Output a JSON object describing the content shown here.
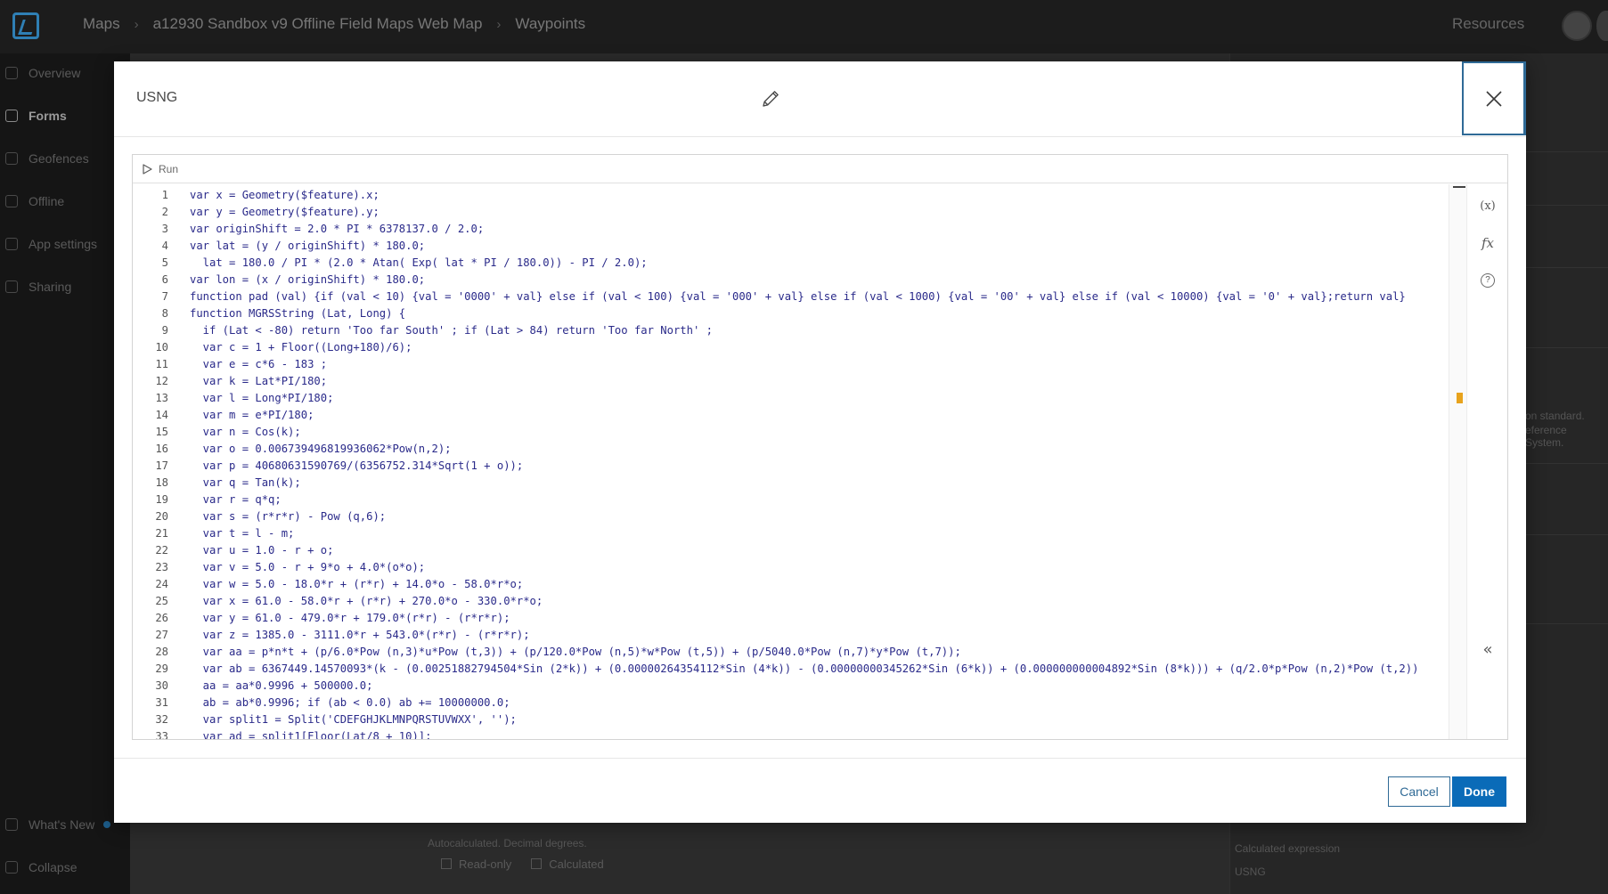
{
  "topbar": {
    "breadcrumbs": [
      "Maps",
      "a12930 Sandbox v9 Offline Field Maps Web Map",
      "Waypoints"
    ],
    "resources_label": "Resources"
  },
  "sidebar": {
    "items": [
      {
        "label": "Overview",
        "icon": "overview-icon"
      },
      {
        "label": "Forms",
        "icon": "forms-icon"
      },
      {
        "label": "Geofences",
        "icon": "geofence-icon"
      },
      {
        "label": "Offline",
        "icon": "offline-icon"
      },
      {
        "label": "App settings",
        "icon": "settings-icon"
      },
      {
        "label": "Sharing",
        "icon": "sharing-icon"
      }
    ],
    "whats_new_label": "What's New",
    "collapse_label": "Collapse"
  },
  "background": {
    "field_hint": "Autocalculated. Decimal degrees.",
    "badge_readonly": "Read-only",
    "badge_calculated": "Calculated",
    "right_hint_1": "on standard.",
    "right_hint_2": "eference System.",
    "calc_expression_label": "Calculated expression",
    "calc_expression_value": "USNG"
  },
  "modal": {
    "title": "USNG",
    "run_label": "Run",
    "cancel_label": "Cancel",
    "done_label": "Done",
    "tools": [
      "(x)",
      "fx",
      "?"
    ],
    "collapse_symbol": "«",
    "accent_color": "#0a6bb8"
  },
  "code": {
    "lines": [
      "var x = Geometry($feature).x;",
      "var y = Geometry($feature).y;",
      "var originShift = 2.0 * PI * 6378137.0 / 2.0;",
      "var lat = (y / originShift) * 180.0;",
      "  lat = 180.0 / PI * (2.0 * Atan( Exp( lat * PI / 180.0)) - PI / 2.0);",
      "var lon = (x / originShift) * 180.0;",
      "function pad (val) {if (val < 10) {val = '0000' + val} else if (val < 100) {val = '000' + val} else if (val < 1000) {val = '00' + val} else if (val < 10000) {val = '0' + val};return val}",
      "function MGRSString (Lat, Long) {",
      "  if (Lat < -80) return 'Too far South' ; if (Lat > 84) return 'Too far North' ;",
      "  var c = 1 + Floor((Long+180)/6);",
      "  var e = c*6 - 183 ;",
      "  var k = Lat*PI/180;",
      "  var l = Long*PI/180;",
      "  var m = e*PI/180;",
      "  var n = Cos(k);",
      "  var o = 0.006739496819936062*Pow(n,2);",
      "  var p = 40680631590769/(6356752.314*Sqrt(1 + o));",
      "  var q = Tan(k);",
      "  var r = q*q;",
      "  var s = (r*r*r) - Pow (q,6);",
      "  var t = l - m;",
      "  var u = 1.0 - r + o;",
      "  var v = 5.0 - r + 9*o + 4.0*(o*o);",
      "  var w = 5.0 - 18.0*r + (r*r) + 14.0*o - 58.0*r*o;",
      "  var x = 61.0 - 58.0*r + (r*r) + 270.0*o - 330.0*r*o;",
      "  var y = 61.0 - 479.0*r + 179.0*(r*r) - (r*r*r);",
      "  var z = 1385.0 - 3111.0*r + 543.0*(r*r) - (r*r*r);",
      "  var aa = p*n*t + (p/6.0*Pow (n,3)*u*Pow (t,3)) + (p/120.0*Pow (n,5)*w*Pow (t,5)) + (p/5040.0*Pow (n,7)*y*Pow (t,7));",
      "  var ab = 6367449.14570093*(k - (0.00251882794504*Sin (2*k)) + (0.00000264354112*Sin (4*k)) - (0.00000000345262*Sin (6*k)) + (0.000000000004892*Sin (8*k))) + (q/2.0*p*Pow (n,2)*Pow (t,2))",
      "  aa = aa*0.9996 + 500000.0;",
      "  ab = ab*0.9996; if (ab < 0.0) ab += 10000000.0;",
      "  var split1 = Split('CDEFGHJKLMNPQRSTUVWXX', '');",
      "  var ad = split1[Floor(Lat/8 + 10)];"
    ]
  }
}
